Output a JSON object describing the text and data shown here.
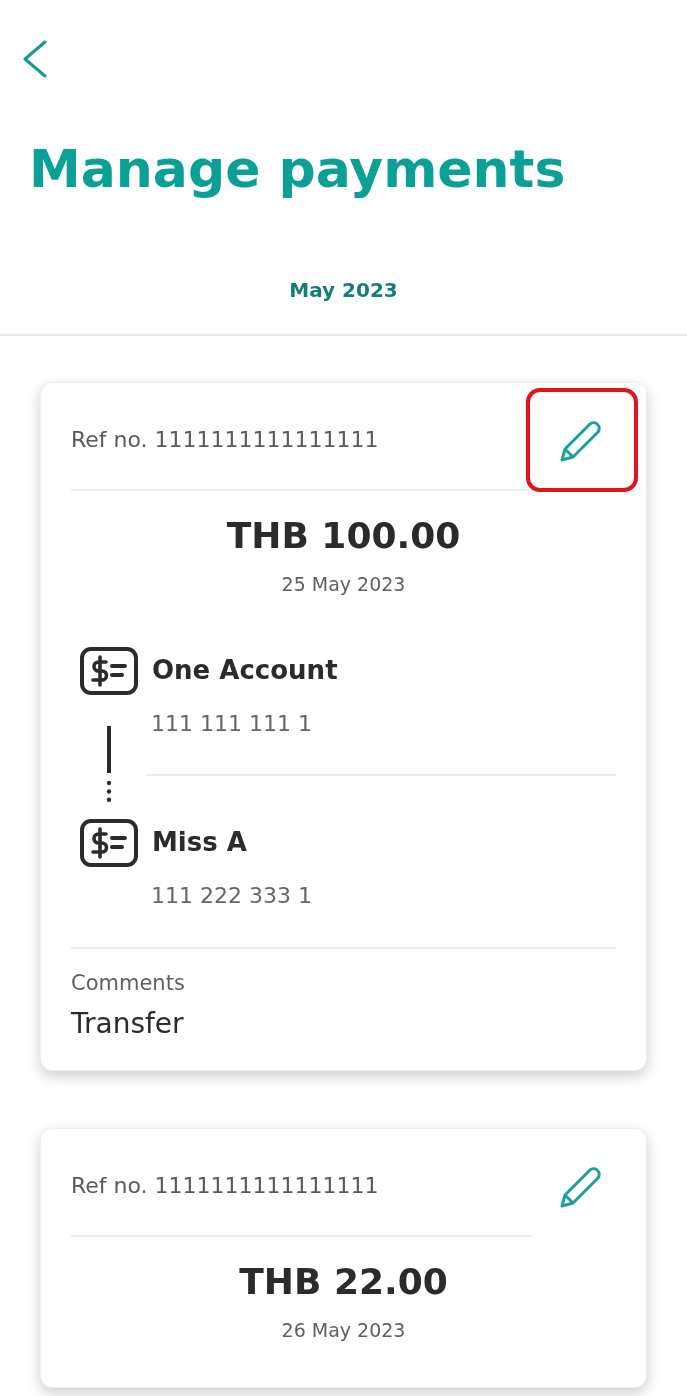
{
  "header": {
    "title": "Manage payments"
  },
  "month": "May 2023",
  "payments": [
    {
      "ref": "Ref no. 1111111111111111",
      "edit": {
        "highlighted": true
      },
      "amount": "THB 100.00",
      "date": "25 May 2023",
      "accounts": [
        {
          "name": "One Account",
          "number": "111 111 111 1"
        },
        {
          "name": "Miss A",
          "number": "111 222 333 1"
        }
      ],
      "comments_label": "Comments",
      "comment": "Transfer"
    },
    {
      "ref": "Ref no. 1111111111111111",
      "edit": {
        "highlighted": false
      },
      "amount": "THB 22.00",
      "date": "26 May 2023"
    }
  ]
}
